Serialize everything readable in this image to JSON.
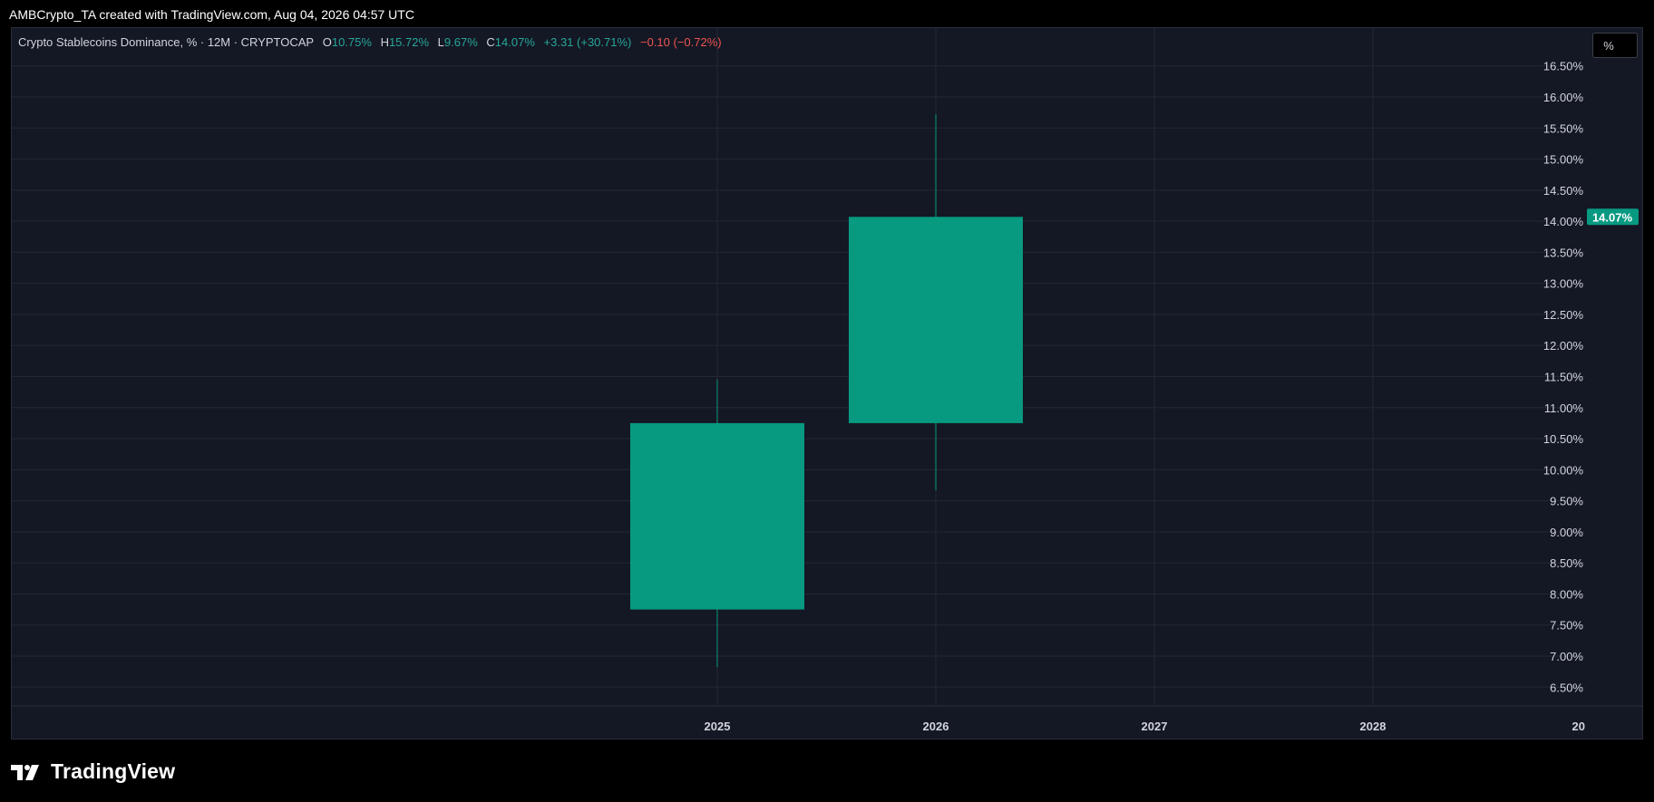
{
  "header": {
    "attribution": "AMBCrypto_TA created with TradingView.com, Aug 04, 2026 04:57 UTC"
  },
  "legend": {
    "symbol": "Crypto Stablecoins Dominance, % · 12M · CRYPTOCAP",
    "o_label": "O",
    "o_value": "10.75%",
    "h_label": "H",
    "h_value": "15.72%",
    "l_label": "L",
    "l_value": "9.67%",
    "c_label": "C",
    "c_value": "14.07%",
    "change": "+3.31 (+30.71%)",
    "extra_change": "−0.10 (−0.72%)"
  },
  "toolbar": {
    "scale_label": "%"
  },
  "footer": {
    "brand": "TradingView",
    "logo_icon": "tradingview-logo-icon"
  },
  "colors": {
    "background": "#141824",
    "grid": "#232734",
    "up": "#089981",
    "up_text": "#26a69a",
    "down_text": "#ef5350",
    "axis_text": "#d1d4dc"
  },
  "chart_data": {
    "type": "candlestick",
    "title": "Crypto Stablecoins Dominance, % · 12M · CRYPTOCAP",
    "candles": [
      {
        "x": "2025",
        "open": 7.75,
        "high": 11.45,
        "low": 6.82,
        "close": 10.75
      },
      {
        "x": "2026",
        "open": 10.75,
        "high": 15.72,
        "low": 9.67,
        "close": 14.07
      }
    ],
    "x_ticks": [
      "2025",
      "2026",
      "2027",
      "2028",
      "20"
    ],
    "y_ticks": [
      "6.50%",
      "7.00%",
      "7.50%",
      "8.00%",
      "8.50%",
      "9.00%",
      "9.50%",
      "10.00%",
      "10.50%",
      "11.00%",
      "11.50%",
      "12.00%",
      "12.50%",
      "13.00%",
      "13.50%",
      "14.00%",
      "14.50%",
      "15.00%",
      "15.50%",
      "16.00%",
      "16.50%"
    ],
    "y_tick_values": [
      6.5,
      7.0,
      7.5,
      8.0,
      8.5,
      9.0,
      9.5,
      10.0,
      10.5,
      11.0,
      11.5,
      12.0,
      12.5,
      13.0,
      13.5,
      14.0,
      14.5,
      15.0,
      15.5,
      16.0,
      16.5
    ],
    "last_price_label": "14.07%",
    "last_price": 14.07,
    "grid": true,
    "y_axis_position": "right"
  }
}
